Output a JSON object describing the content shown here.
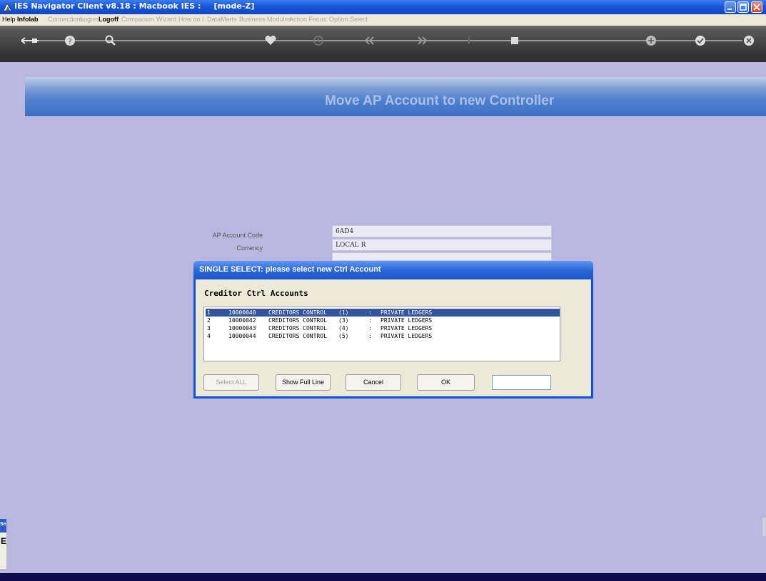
{
  "window": {
    "title": "IES Navigator Client v8.18 : Macbook IES :",
    "mode": "[mode-Z]"
  },
  "menu": [
    {
      "label": "Help",
      "state": "on"
    },
    {
      "label": "Infolab",
      "state": "bold"
    },
    {
      "label": "Connections",
      "state": "off"
    },
    {
      "label": "Logon",
      "state": "off"
    },
    {
      "label": "Logoff",
      "state": "bold"
    },
    {
      "label": "Companion",
      "state": "off"
    },
    {
      "label": "Wizard",
      "state": "off"
    },
    {
      "label": "How do I",
      "state": "off"
    },
    {
      "label": "DataMarts",
      "state": "off"
    },
    {
      "label": "Business Modules",
      "state": "off"
    },
    {
      "label": "Action Focus",
      "state": "off"
    },
    {
      "label": "Option Select",
      "state": "off"
    }
  ],
  "toolbar": {
    "icons": [
      "back-arrow-icon",
      "help-icon",
      "search-icon",
      "heart-icon",
      "clock-icon",
      "rewind-icon",
      "fast-forward-icon",
      "info-icon",
      "stop-icon",
      "add-icon",
      "check-icon",
      "close-icon"
    ]
  },
  "banner": {
    "title": "Move AP Account to new Controller"
  },
  "form": {
    "fields": [
      {
        "label": "AP Account Code",
        "value": "6AD4"
      },
      {
        "label": "Currency",
        "value": "LOCAL R"
      }
    ]
  },
  "dialog": {
    "title": "SINGLE SELECT: please select new Ctrl Account",
    "header": "Creditor Ctrl Accounts",
    "rows": [
      {
        "num": "1",
        "code": "10000040",
        "desc": "CREDITORS CONTROL",
        "paren": "(1)",
        "sep": ":",
        "ledger": "PRIVATE LEDGERS",
        "selected": true
      },
      {
        "num": "2",
        "code": "10000042",
        "desc": "CREDITORS CONTROL",
        "paren": "(3)",
        "sep": ":",
        "ledger": "PRIVATE LEDGERS",
        "selected": false
      },
      {
        "num": "3",
        "code": "10000043",
        "desc": "CREDITORS CONTROL",
        "paren": "(4)",
        "sep": ":",
        "ledger": "PRIVATE LEDGERS",
        "selected": false
      },
      {
        "num": "4",
        "code": "10000044",
        "desc": "CREDITORS CONTROL",
        "paren": "(5)",
        "sep": ":",
        "ledger": "PRIVATE LEDGERS",
        "selected": false
      }
    ],
    "buttons": {
      "select_all": "Select ALL",
      "show_full_line": "Show Full Line",
      "cancel": "Cancel",
      "ok": "OK"
    }
  },
  "side_fragment": {
    "title": "Se",
    "value": "E"
  },
  "colors": {
    "background": "#b9b7dd",
    "titlebar": "#1a56d6",
    "banner": "#4e80ce",
    "banner_text": "#a8bfe6",
    "dialog_frame": "#0c52d4",
    "selection": "#33559e"
  }
}
